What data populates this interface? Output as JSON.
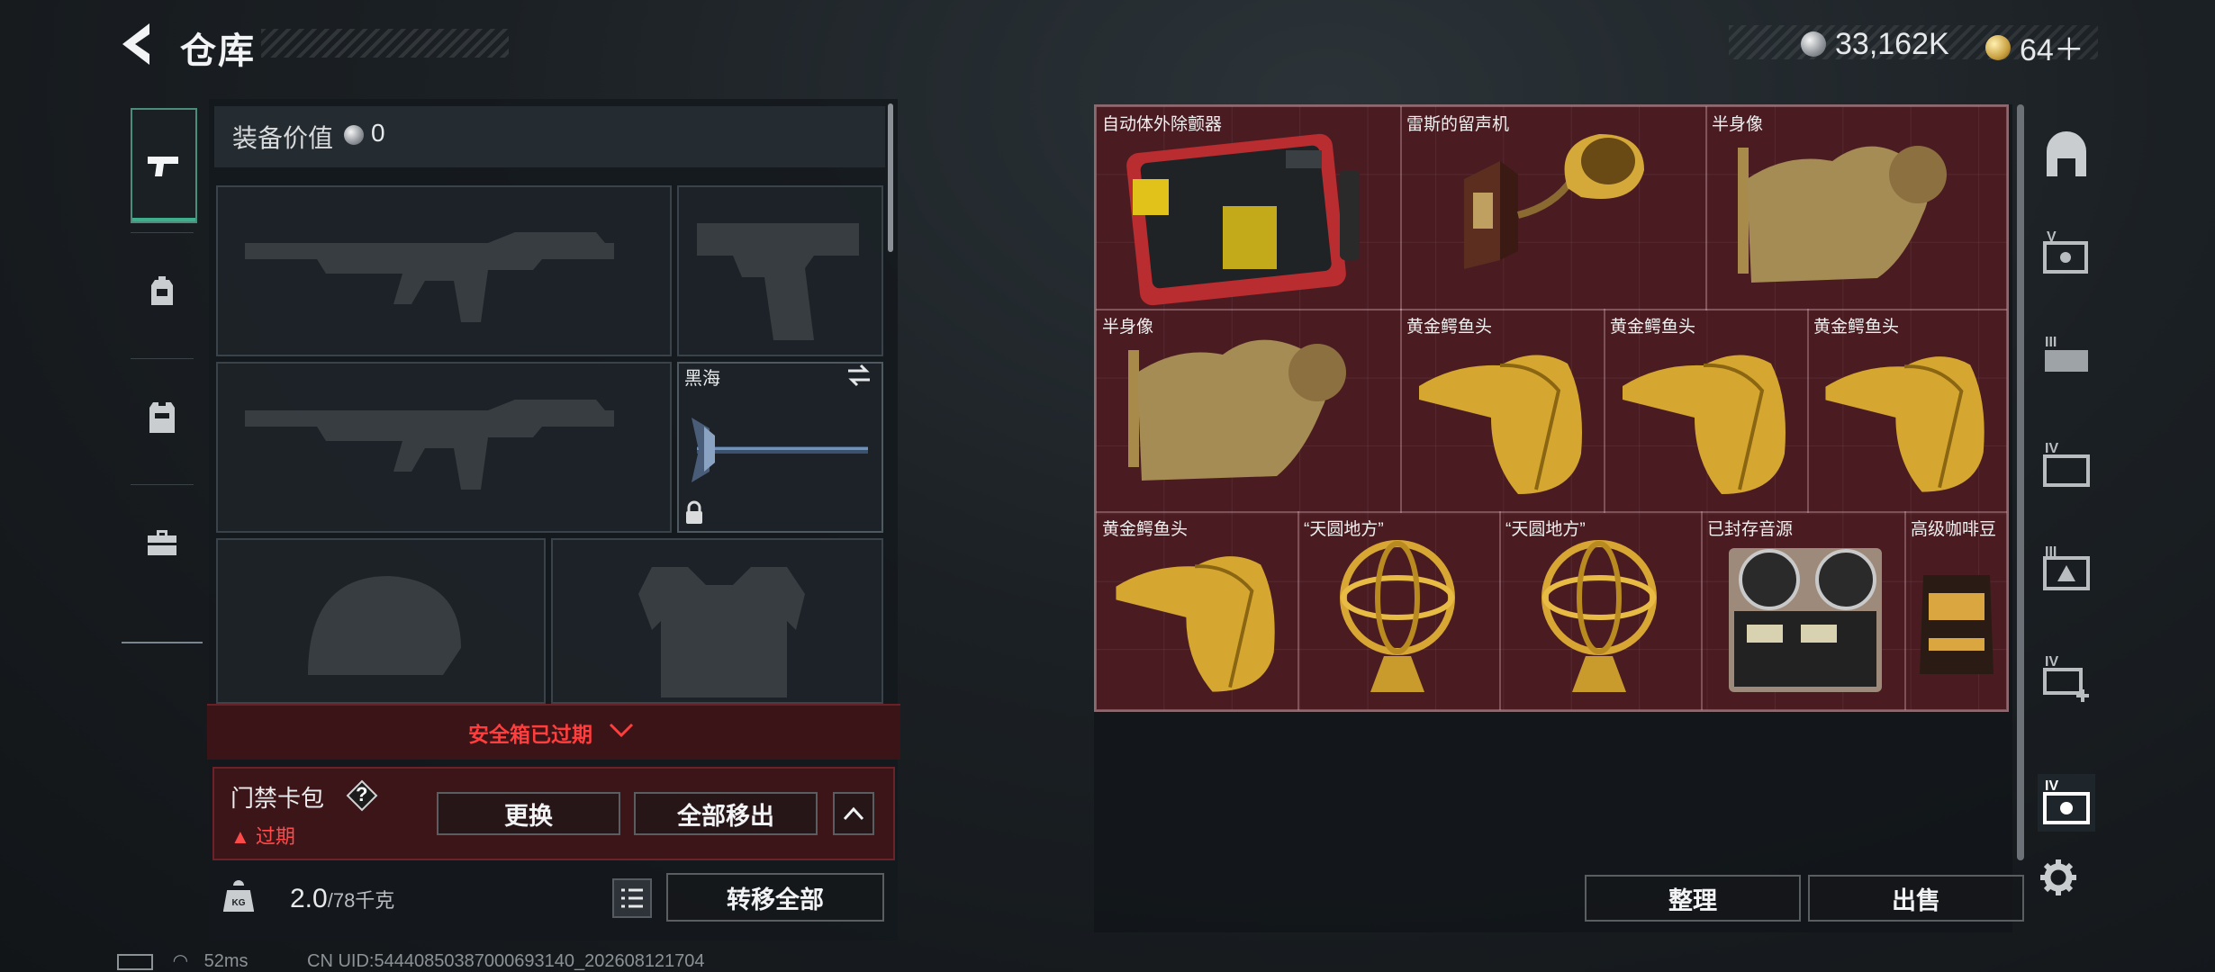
{
  "header": {
    "title": "仓库",
    "currency": [
      {
        "value": "33,162K",
        "icon": "silver-coin-icon"
      },
      {
        "value": "64＋",
        "icon": "gold-coin-icon"
      }
    ]
  },
  "left_tabs": [
    "pistol-icon",
    "backpack-icon",
    "vest-icon",
    "toolbox-icon"
  ],
  "equipment": {
    "value_label": "装备价值",
    "value": "0",
    "melee_name": "黑海"
  },
  "safe_box": {
    "status": "安全箱已过期",
    "card_label": "门禁卡包",
    "card_help": "?",
    "card_status": "过期",
    "replace_label": "更换",
    "move_all_label": "全部移出"
  },
  "weight": {
    "current": "2.0",
    "max": "/78千克",
    "transfer_label": "转移全部"
  },
  "stash": {
    "items": [
      {
        "name": "自动体外除颤器",
        "icon": "defibrillator-icon"
      },
      {
        "name": "雷斯的留声机",
        "icon": "gramophone-icon"
      },
      {
        "name": "半身像",
        "icon": "bust-icon"
      },
      {
        "name": "半身像",
        "icon": "bust-icon"
      },
      {
        "name": "黄金鳄鱼头",
        "icon": "gold-crocodile-head-icon"
      },
      {
        "name": "黄金鳄鱼头",
        "icon": "gold-crocodile-head-icon"
      },
      {
        "name": "黄金鳄鱼头",
        "icon": "gold-crocodile-head-icon"
      },
      {
        "name": "黄金鳄鱼头",
        "icon": "gold-crocodile-head-icon"
      },
      {
        "name": "“天圆地方”",
        "icon": "armillary-sphere-icon"
      },
      {
        "name": "“天圆地方”",
        "icon": "armillary-sphere-icon"
      },
      {
        "name": "已封存音源",
        "icon": "tape-recorder-icon"
      },
      {
        "name": "高级咖啡豆",
        "icon": "coffee-bag-icon"
      }
    ],
    "sort_label": "整理",
    "sell_label": "出售",
    "side_tabs": [
      "home-icon",
      "v-case-icon",
      "iii-case-icon",
      "iv-case-icon",
      "iii-box-icon",
      "iv-plus-icon",
      "iv-case-active-icon"
    ]
  },
  "footer": {
    "ping": "52ms",
    "uid": "CN UID:544408503870006931​40_202608121704"
  },
  "colors": {
    "accent_red": "#ff3d3d",
    "stash_bg": "#4a1c22",
    "active_tab": "#3fae8d"
  }
}
